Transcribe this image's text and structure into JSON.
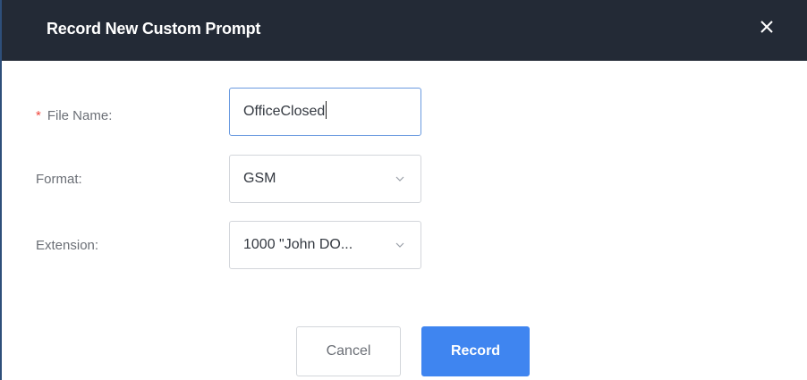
{
  "dialog": {
    "title": "Record New Custom Prompt",
    "close_icon": "close-icon"
  },
  "form": {
    "file_name": {
      "required_mark": "*",
      "label": "File Name:",
      "value": "OfficeClosed"
    },
    "format": {
      "label": "Format:",
      "selected": "GSM"
    },
    "extension": {
      "label": "Extension:",
      "selected": "1000 \"John DO..."
    }
  },
  "actions": {
    "cancel_label": "Cancel",
    "record_label": "Record"
  },
  "colors": {
    "header_bg": "#232a36",
    "primary": "#3f85f0",
    "required": "#f0483e",
    "focus_border": "#6a9ae0"
  }
}
